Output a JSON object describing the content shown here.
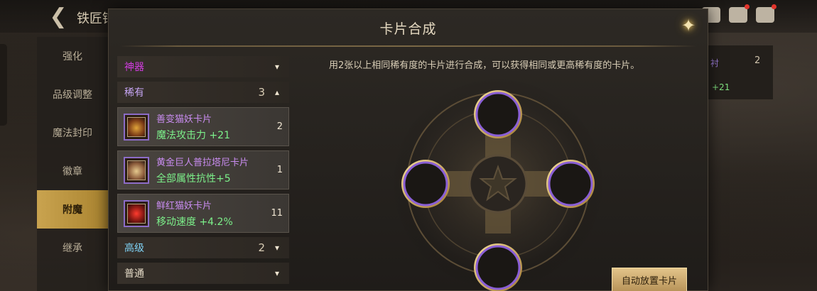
{
  "topbar": {
    "title": "铁匠铺",
    "back_icon": "arrow-left-icon",
    "icons": [
      "settings-icon",
      "mail-icon",
      "chat-icon"
    ]
  },
  "side_tabs": [
    {
      "label": "强化"
    },
    {
      "label": "品级调整"
    },
    {
      "label": "魔法封印"
    },
    {
      "label": "徽章"
    },
    {
      "label": "附魔",
      "active": true
    },
    {
      "label": "继承"
    }
  ],
  "background_panel": {
    "text1": "衬",
    "num": "2",
    "text2": "+21"
  },
  "modal": {
    "title": "卡片合成",
    "close_icon": "close-star-icon",
    "description": "用2张以上相同稀有度的卡片进行合成，可以获得相同或更高稀有度的卡片。",
    "auto_button": "自动放置卡片"
  },
  "categories": {
    "artifact": {
      "label": "神器",
      "chevron": "▾"
    },
    "rare": {
      "label": "稀有",
      "count": "3",
      "chevron": "▴"
    },
    "advanced": {
      "label": "高级",
      "count": "2",
      "chevron": "▾"
    },
    "normal": {
      "label": "普通",
      "chevron": "▾"
    }
  },
  "cards": [
    {
      "name": "善变猫妖卡片",
      "stat": "魔法攻击力 +21",
      "qty": "2"
    },
    {
      "name": "黄金巨人普拉塔尼卡片",
      "stat": "全部属性抗性+5",
      "qty": "1"
    },
    {
      "name": "鲜红猫妖卡片",
      "stat": "移动速度 +4.2%",
      "qty": "11"
    }
  ],
  "colors": {
    "accent_gold": "#c9a34f",
    "rare_purple": "#c7a6f5",
    "artifact_magenta": "#d13ce0",
    "stat_green": "#7cf08a",
    "advanced_blue": "#7fd2f5"
  }
}
